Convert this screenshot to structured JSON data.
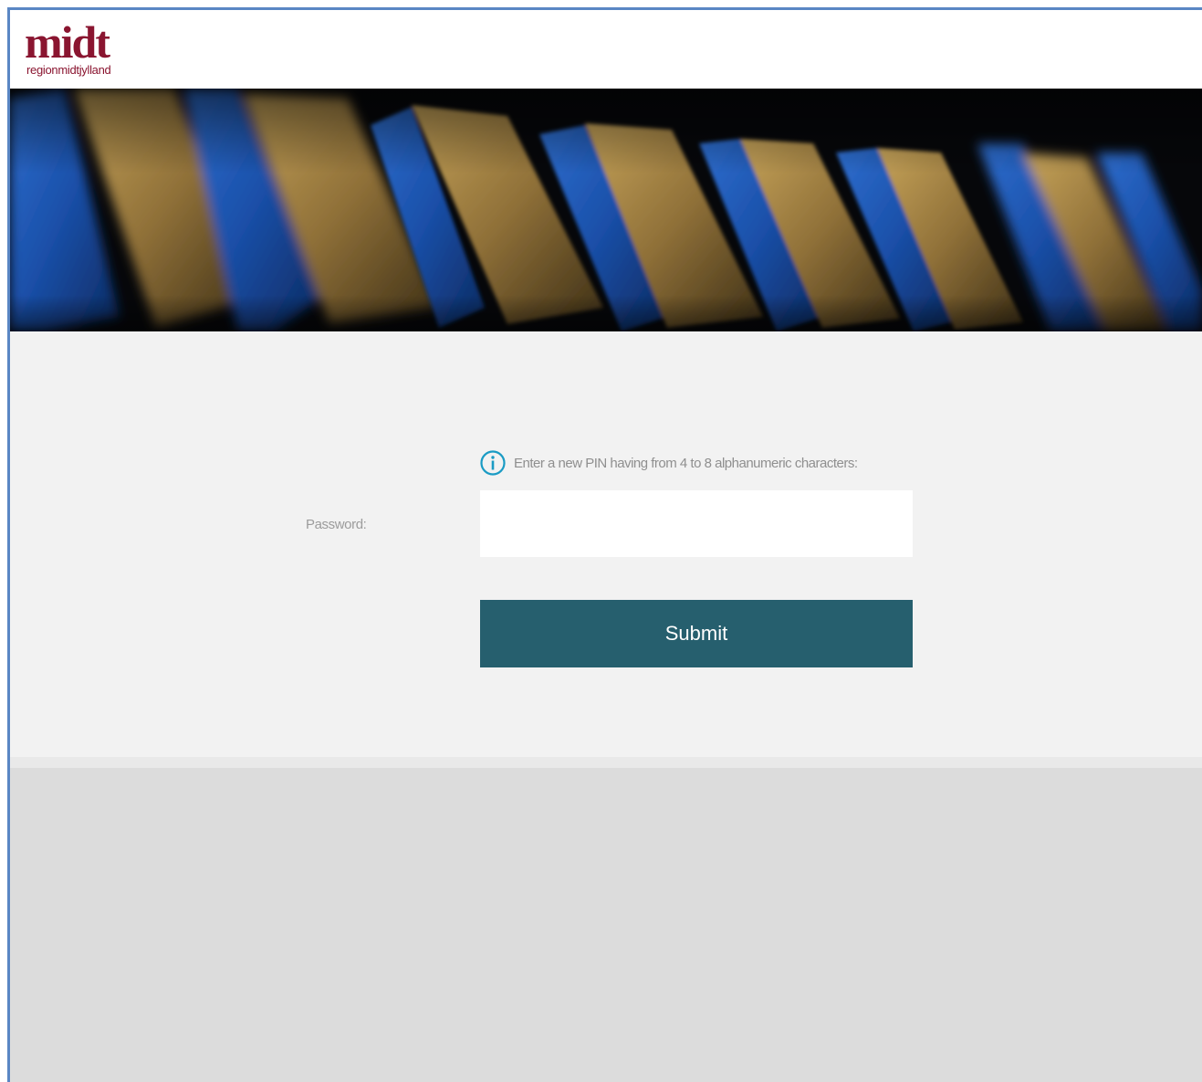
{
  "header": {
    "logo_mark": "midt",
    "logo_subtext": "regionmidtjylland",
    "brand_color": "#8a1530"
  },
  "banner": {
    "image_alt": "keyboard-keys-photo"
  },
  "form": {
    "info_icon": "info-circle-icon",
    "info_color": "#1a9bc4",
    "hint_text": "Enter a new PIN having from 4 to 8 alphanumeric characters:",
    "password_label": "Password:",
    "password_value": "",
    "submit_label": "Submit",
    "submit_color": "#265f6e"
  },
  "colors": {
    "frame_border": "#5a86c4",
    "content_bg": "#f2f2f2",
    "footer_bg": "#dcdcdc"
  }
}
